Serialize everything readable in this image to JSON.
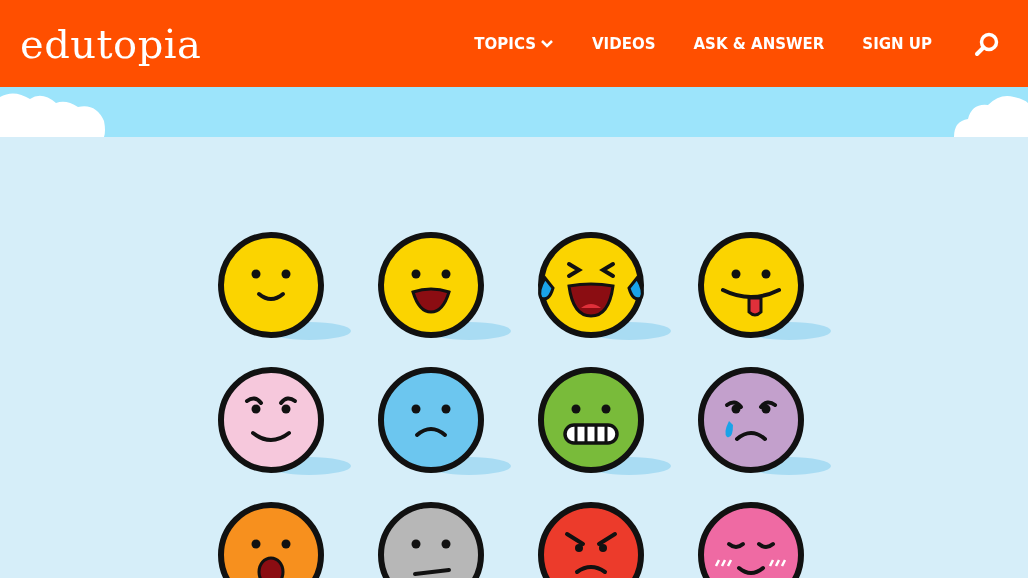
{
  "header": {
    "logo": "edutopia",
    "nav": [
      {
        "label": "TOPICS",
        "has_dropdown": true
      },
      {
        "label": "VIDEOS",
        "has_dropdown": false
      },
      {
        "label": "ASK & ANSWER",
        "has_dropdown": false
      },
      {
        "label": "SIGN UP",
        "has_dropdown": false
      }
    ]
  }
}
